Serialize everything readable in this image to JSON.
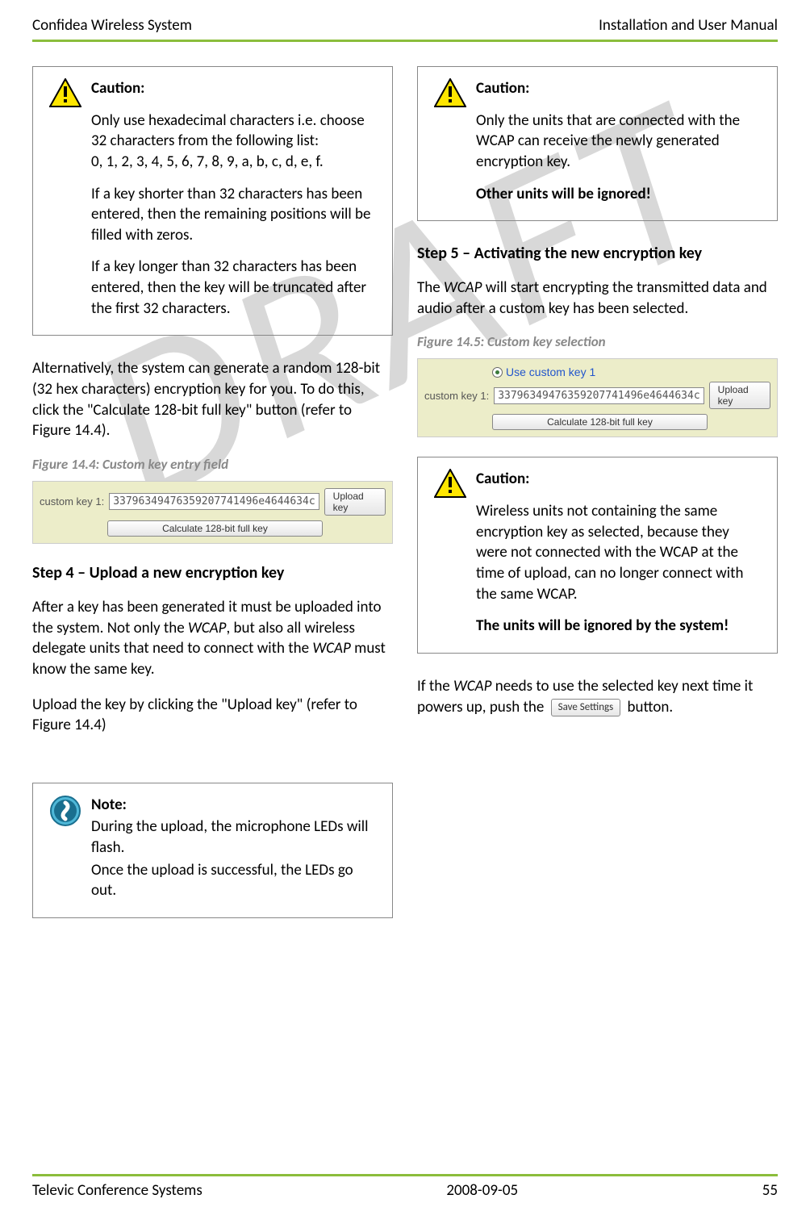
{
  "header": {
    "left": "Confidea Wireless System",
    "right": "Installation and User Manual"
  },
  "footer": {
    "left": "Televic Conference Systems",
    "center": "2008-09-05",
    "right": "55"
  },
  "watermark": "DRAFT",
  "leftCol": {
    "caution1": {
      "title": "Caution:",
      "p1": "Only use hexadecimal characters i.e. choose 32 characters from the following list:",
      "p1b": "0, 1, 2, 3, 4, 5, 6, 7, 8, 9, a, b, c, d, e, f.",
      "p2": "If a key shorter than 32 characters has been entered, then the remaining positions will be filled with zeros.",
      "p3": "If a key longer than 32 characters has been entered, then the key will be truncated after the first 32 characters."
    },
    "para1": "Alternatively, the system can generate a random 128-bit (32 hex characters) encryption key for you. To do this, click the \"Calculate 128-bit full key\" button (refer to Figure 14.4).",
    "fig14_4_caption": "Figure 14.4: Custom key entry field",
    "fig14_4": {
      "label": "custom key 1:",
      "value": "33796349476359207741496e4644634c",
      "calcBtn": "Calculate 128-bit full key",
      "uploadBtn": "Upload key"
    },
    "step4_heading": "Step 4 – Upload a new encryption key",
    "step4_p1a": "After a key has been generated it must be uploaded into the system. Not only the ",
    "step4_p1_wcap": "WCAP",
    "step4_p1b": ", but also all wireless delegate units that need to connect with the ",
    "step4_p1c": " must know the same key.",
    "step4_p2": "Upload the key by clicking the \"Upload key\" (refer to Figure 14.4)",
    "note": {
      "title": "Note:",
      "p1": "During the upload, the microphone LEDs will flash.",
      "p2": "Once the upload is successful, the LEDs go out."
    }
  },
  "rightCol": {
    "caution2": {
      "title": "Caution:",
      "p1": "Only the units that are connected with the WCAP can receive the newly generated encryption key.",
      "p2": "Other units will be ignored!"
    },
    "step5_heading": "Step 5 – Activating the new encryption key",
    "step5_p1a": "The ",
    "step5_p1_wcap": "WCAP",
    "step5_p1b": " will start encrypting the transmitted data and audio after a custom key has been selected.",
    "fig14_5_caption": "Figure 14.5: Custom key selection",
    "fig14_5": {
      "radio": "Use custom key 1",
      "label": "custom key 1:",
      "value": "33796349476359207741496e4644634c",
      "calcBtn": "Calculate 128-bit full key",
      "uploadBtn": "Upload key"
    },
    "caution3": {
      "title": "Caution:",
      "p1": "Wireless units not containing the same encryption key as selected, because they were not connected with the WCAP at the time of upload, can no longer connect with the same WCAP.",
      "p2": "The units will be ignored by the system!"
    },
    "finalPara_a": "If the ",
    "finalPara_wcap": "WCAP",
    "finalPara_b": " needs to use the selected key next time it powers up, push the ",
    "saveBtn": "Save Settings",
    "finalPara_c": " button."
  }
}
